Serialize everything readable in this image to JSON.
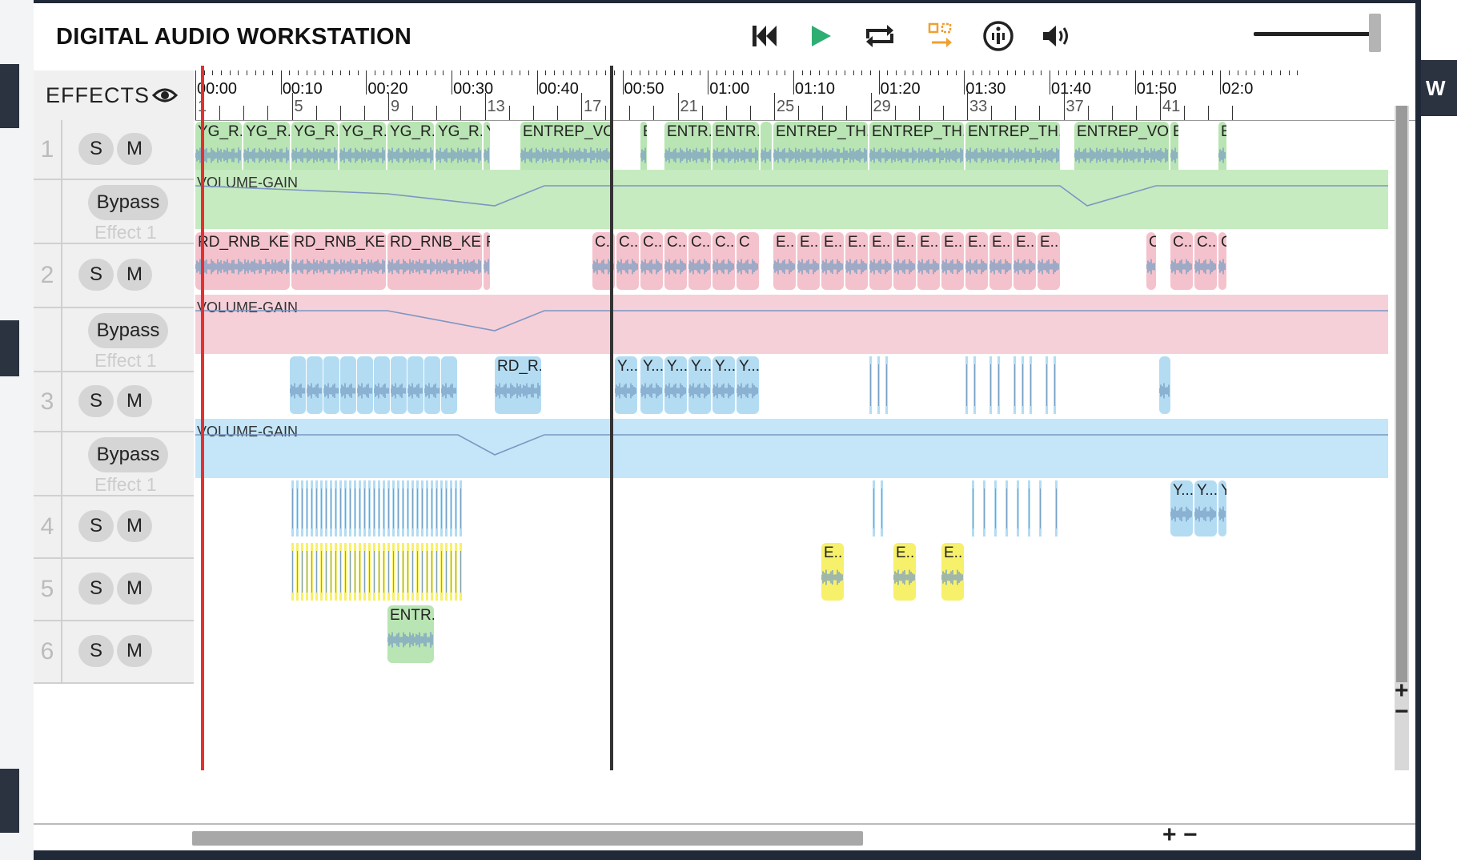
{
  "app": {
    "title": "DIGITAL AUDIO WORKSTATION"
  },
  "toolbar": {
    "skip_back": "skip-back-icon",
    "play": "play-icon",
    "loop": "loop-icon",
    "select": "selection-icon",
    "info": "info-icon",
    "volume": "volume-icon",
    "volume_level": 1.0
  },
  "sidebar": {
    "effects_label": "EFFECTS",
    "solo_label": "S",
    "mute_label": "M",
    "bypass_label": "Bypass",
    "effect_label": "Effect 1"
  },
  "ruler": {
    "time_labels": [
      "00:00",
      "00:10",
      "00:20",
      "00:30",
      "00:40",
      "00:50",
      "01:00",
      "01:10",
      "01:20",
      "01:30",
      "01:40",
      "01:50",
      "02:0"
    ],
    "bar_labels": [
      "1",
      "5",
      "9",
      "13",
      "17",
      "21",
      "25",
      "29",
      "33",
      "37",
      "41"
    ]
  },
  "tracks": [
    {
      "number": "1",
      "effect_name": "VOLUME-GAIN",
      "color": "#b9e4b3",
      "clips": [
        "YG_R...",
        "YG_R...",
        "YG_R...",
        "YG_R...",
        "YG_R...",
        "YG_R...",
        "Y",
        "ENTREP_VO...",
        "E",
        "ENTR...",
        "ENTR...",
        "",
        "ENTREP_TH...",
        "ENTREP_TH...",
        "ENTREP_TH...",
        "ENTREP_VO...",
        "E",
        "E"
      ]
    },
    {
      "number": "2",
      "effect_name": "VOLUME-GAIN",
      "color": "#f4c2cc",
      "clips": [
        "RD_RNB_KEY...",
        "RD_RNB_KEY...",
        "RD_RNB_KEY...",
        "F",
        "C...",
        "C...",
        "C...",
        "C...",
        "C...",
        "C...",
        "C",
        "E...",
        "E...",
        "E...",
        "E...",
        "E...",
        "E...",
        "E...",
        "E...",
        "E...",
        "E...",
        "E...",
        "E...",
        "C",
        "C...",
        "C...",
        "C"
      ]
    },
    {
      "number": "3",
      "effect_name": "VOLUME-GAIN",
      "color": "#b3dcf3",
      "clips": [
        "RD_R...",
        "Y...",
        "Y...",
        "Y...",
        "Y...",
        "Y...",
        "Y..."
      ]
    },
    {
      "number": "4",
      "color": "#b3dcf3",
      "clips": [
        "Y...",
        "Y...",
        "Y"
      ]
    },
    {
      "number": "5",
      "color": "#f7f06a",
      "clips": [
        "E...",
        "E...",
        "E..."
      ]
    },
    {
      "number": "6",
      "color": "#b9e4b3",
      "clips": [
        "ENTR..."
      ]
    }
  ],
  "zoom": {
    "plus": "+",
    "minus": "−"
  },
  "right_panel": {
    "label": "W"
  }
}
